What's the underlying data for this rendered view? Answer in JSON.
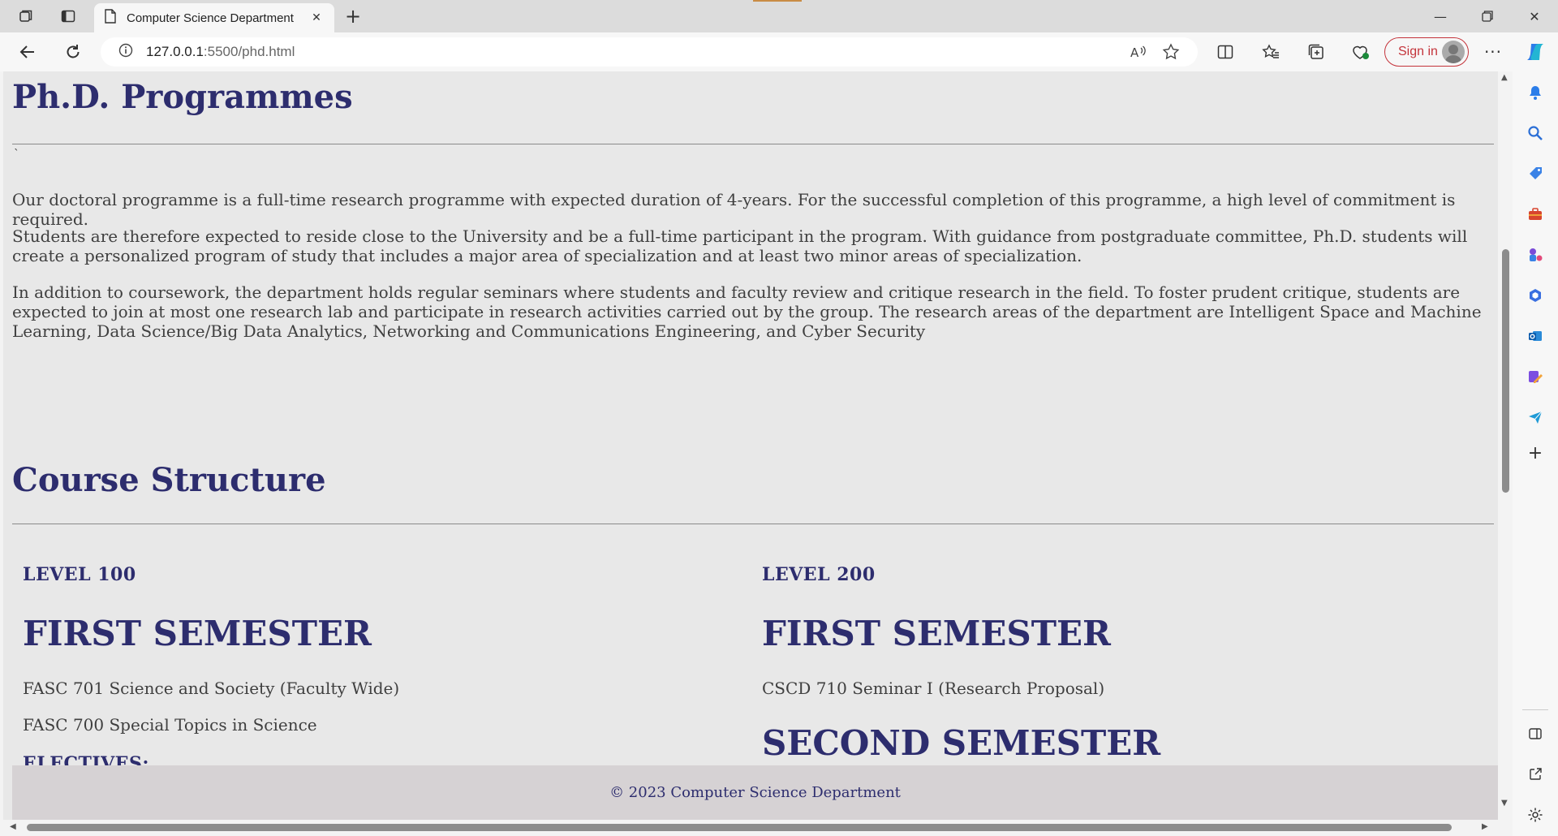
{
  "browser": {
    "tab_title": "Computer Science Department",
    "url_host": "127.0.0.1",
    "url_rest": ":5500/phd.html",
    "signin_label": "Sign in"
  },
  "page": {
    "title": "Ph.D. Programmes",
    "stray_mark": "`",
    "paragraphs": [
      "Our doctoral programme is a full-time research programme with expected duration of 4-years. For the successful completion of this programme, a high level of commitment is required.",
      "Students are therefore expected to reside close to the University and be a full-time participant in the program. With guidance from postgraduate committee, Ph.D. students will create a personalized program of study that includes a major area of specialization and at least two minor areas of specialization.",
      "In addition to coursework, the department holds regular seminars where students and faculty review and critique research in the field. To foster prudent critique, students are expected to join at most one research lab and participate in research activities carried out by the group. The research areas of the department are Intelligent Space and Machine Learning, Data Science/Big Data Analytics, Networking and Communications Engineering, and Cyber Security"
    ],
    "course_structure_title": "Course Structure",
    "level100": {
      "label": "LEVEL 100",
      "first_semester": "FIRST SEMESTER",
      "courses": [
        "FASC 701 Science and Society (Faculty Wide)",
        "FASC 700 Special Topics in Science"
      ],
      "electives": "ELECTIVES:"
    },
    "level200": {
      "label": "LEVEL 200",
      "first_semester": "FIRST SEMESTER",
      "courses": [
        "CSCD 710 Seminar I (Research Proposal)"
      ],
      "second_semester": "SECOND SEMESTER"
    },
    "footer": "© 2023 Computer Science Department"
  },
  "colors": {
    "heading": "#2d2d6e",
    "signin": "#c4343b",
    "footer_bg": "#d6d2d4"
  }
}
